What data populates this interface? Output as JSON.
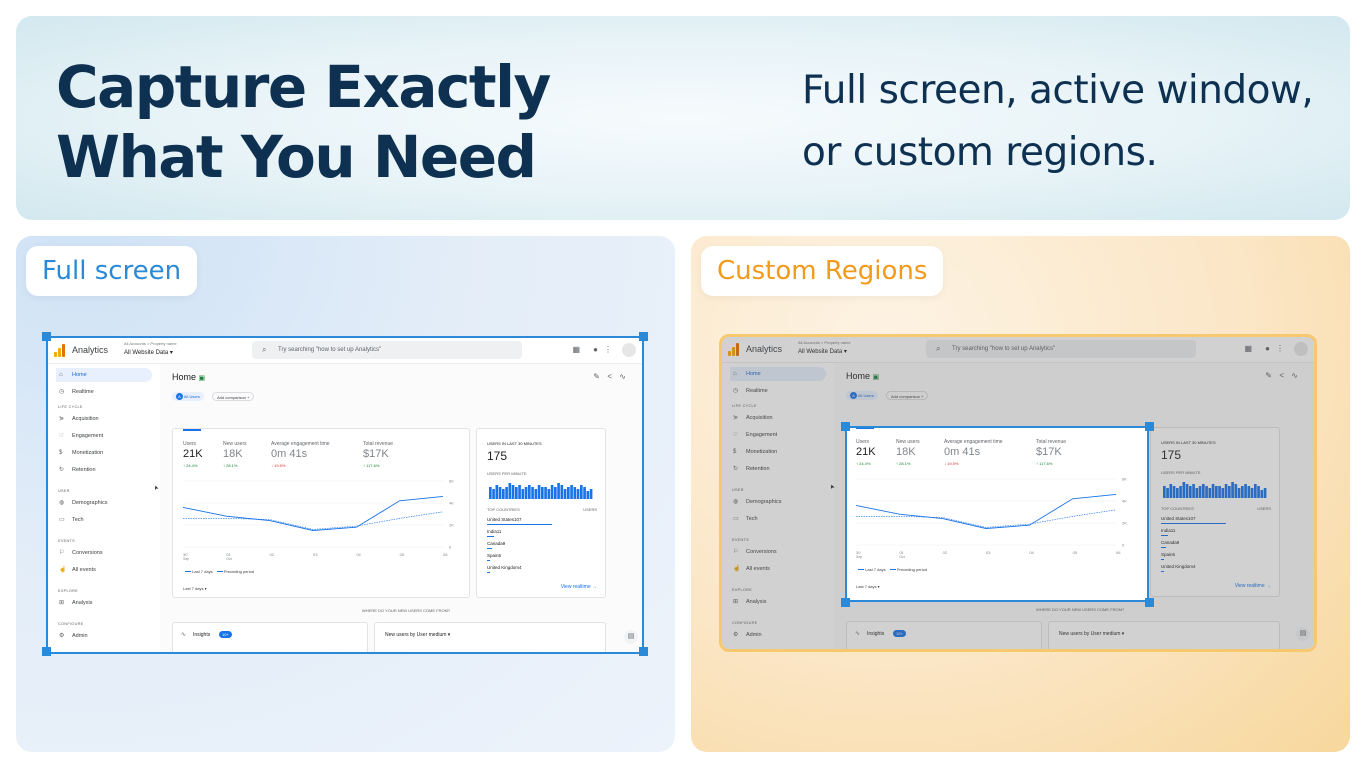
{
  "hero": {
    "title_line1": "Capture Exactly",
    "title_line2": "What You Need",
    "subtitle_line1": "Full screen, active window,",
    "subtitle_line2": "or custom regions."
  },
  "panels": {
    "left_label": "Full screen",
    "right_label": "Custom Regions"
  },
  "colors": {
    "selection": "#2a8ad7",
    "custom_accent": "#f19a1c",
    "hero_text": "#0e3152"
  },
  "analytics": {
    "brand": "Analytics",
    "account_path": "All Accounts > Property name",
    "property": "All Website Data",
    "search_placeholder": "Try searching \"how to set up Analytics\"",
    "nav": {
      "home": "Home",
      "realtime": "Realtime",
      "lifecycle": "LIFE CYCLE",
      "acquisition": "Acquisition",
      "engagement": "Engagement",
      "monetization": "Monetization",
      "retention": "Retention",
      "user": "USER",
      "demographics": "Demographics",
      "tech": "Tech",
      "events": "EVENTS",
      "conversions": "Conversions",
      "all_events": "All events",
      "explore": "EXPLORE",
      "analysis": "Analysis",
      "configure": "CONFIGURE",
      "admin": "Admin"
    },
    "page_title": "Home",
    "all_users": "All Users",
    "add_comparison": "Add comparison",
    "metrics": [
      {
        "label": "Users",
        "value": "21K",
        "delta": "↑ 24.4%"
      },
      {
        "label": "New users",
        "value": "18K",
        "delta": "↑ 28.1%"
      },
      {
        "label": "Average engagement time",
        "value": "0m 41s",
        "delta": "↓ 19.5%"
      },
      {
        "label": "Total revenue",
        "value": "$17K",
        "delta": "↑ 117.6%"
      }
    ],
    "chart_x_labels": [
      "30",
      "01",
      "02",
      "03",
      "04",
      "05",
      "06"
    ],
    "chart_x_sub": [
      "Sep",
      "Oct"
    ],
    "chart_y_labels": [
      "6K",
      "4K",
      "2K",
      "0"
    ],
    "legend_current": "Last 7 days",
    "legend_previous": "Preceding period",
    "date_range": "Last 7 days",
    "realtime": {
      "title": "USERS IN LAST 30 MINUTES",
      "value": "175",
      "per_minute": "USERS PER MINUTE",
      "top_countries": "TOP COUNTRIES",
      "users_header": "USERS",
      "countries": [
        {
          "name": "United States",
          "users": "107"
        },
        {
          "name": "India",
          "users": "11"
        },
        {
          "name": "Canada",
          "users": "9"
        },
        {
          "name": "Spain",
          "users": "5"
        },
        {
          "name": "United Kingdom",
          "users": "4"
        }
      ],
      "view_link": "View realtime"
    },
    "where_from": "WHERE DO YOUR NEW USERS COME FROM?",
    "insights": "Insights",
    "insights_badge": "10+",
    "new_users_by": "New users by User medium"
  },
  "chart_data": {
    "type": "line",
    "x": [
      "30 Sep",
      "01 Oct",
      "02 Oct",
      "03 Oct",
      "04 Oct",
      "05 Oct",
      "06 Oct"
    ],
    "series": [
      {
        "name": "Last 7 days",
        "values": [
          3.6,
          2.8,
          2.4,
          1.5,
          1.8,
          4.2,
          4.6
        ]
      },
      {
        "name": "Preceding period",
        "values": [
          2.6,
          2.6,
          2.5,
          1.6,
          1.9,
          2.6,
          3.2
        ]
      }
    ],
    "ylim": [
      0,
      6
    ],
    "yticks": [
      "0",
      "2K",
      "4K",
      "6K"
    ],
    "realtime_bars": [
      6,
      5,
      7,
      6,
      5,
      6,
      8,
      7,
      6,
      7,
      5,
      6,
      7,
      6,
      5,
      7,
      6,
      6,
      5,
      7,
      6,
      8,
      7,
      5,
      6,
      7,
      6,
      5,
      7,
      6,
      4,
      5
    ]
  }
}
